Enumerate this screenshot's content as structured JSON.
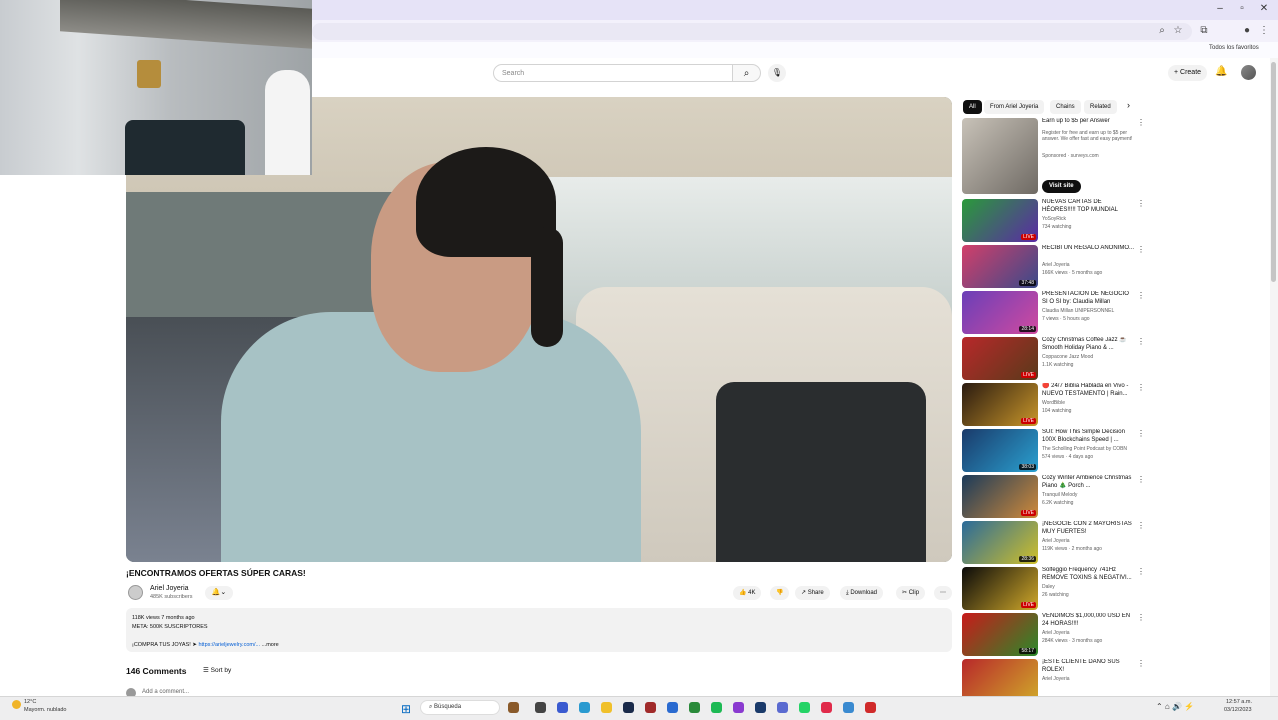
{
  "browser": {
    "bookmarks_label": "Todos los favoritos"
  },
  "header": {
    "search_placeholder": "Search",
    "create_label": "+ Create"
  },
  "video": {
    "title": "¡ENCONTRAMOS OFERTAS SÚPER CARAS!",
    "channel": "Ariel Joyeria",
    "subscribers": "485K subscribers",
    "likes": "4K",
    "share_label": "Share",
    "download_label": "Download",
    "clip_label": "Clip",
    "description_line1": "118K views  7 months ago",
    "description_line2": "META: 500K SUSCRIPTORES",
    "description_line3": "¡COMPRA TUS JOYAS! ➤",
    "description_link": "https://arieljewelry.com/...",
    "description_more": "...more"
  },
  "comments": {
    "count_label": "146 Comments",
    "sort_label": "Sort by",
    "add_placeholder": "Add a comment..."
  },
  "sidebar": {
    "chips": [
      "All",
      "From Ariel Joyeria",
      "Chains",
      "Related"
    ],
    "ad": {
      "title": "Earn up to $5 per Answer",
      "desc": "Register for free and earn up to $5 per answer. We offer fast and easy payment!",
      "sponsor": "Sponsored · surveys.com",
      "button": "Visit site"
    },
    "items": [
      {
        "title": "NUEVAS CARTAS DE HÉORES!!!!! TOP MUNDIAL CLASH ROYALE ...",
        "channel": "YoSoyRick",
        "meta": "734 watching",
        "badge": "LIVE",
        "thumb": "linear-gradient(135deg,#2a9a3a,#5b2aa6)"
      },
      {
        "title": "RECIBÍ UN REGALO ANÓNIMO...",
        "channel": "Ariel Joyeria",
        "meta": "166K views · 5 months ago",
        "badge": "37:48",
        "thumb": "linear-gradient(135deg,#d23f6a,#3a4a8a)"
      },
      {
        "title": "PRESENTACION DE NEGOCIO SI O SI by: Claudia Millan",
        "channel": "Claudia Millan UNIPERSONNEL",
        "meta": "7 views · 5 hours ago",
        "badge": "28:14",
        "thumb": "linear-gradient(135deg,#6a3fb8,#d04aa0)"
      },
      {
        "title": "Cozy Christmas Coffee Jazz ☕ Smooth Holiday Piano & ...",
        "channel": "Coppacone Jazz Mood",
        "meta": "1.1K watching",
        "badge": "LIVE",
        "thumb": "linear-gradient(135deg,#b8282a,#5a3a1a)"
      },
      {
        "title": "🔴 24/7 Biblia Hablada en Vivo - NUEVO TESTAMENTO | Rain...",
        "channel": "WordBible",
        "meta": "104 watching",
        "badge": "LIVE",
        "thumb": "linear-gradient(135deg,#2a1a10,#c8962a)"
      },
      {
        "title": "SUI: How This Simple Decision 100X Blockchains Speed | ...",
        "channel": "The Scholling Point Podcast by COBN",
        "meta": "574 views · 4 days ago",
        "badge": "38:03",
        "thumb": "linear-gradient(135deg,#1a3a6a,#2aa0d0)"
      },
      {
        "title": "Cozy Winter Ambience Christmas Piano 🎄 Porch ...",
        "channel": "Tranquil Melody",
        "meta": "6.2K watching",
        "badge": "LIVE",
        "thumb": "linear-gradient(135deg,#1a3a5a,#d08a3a)"
      },
      {
        "title": "¡NEGOCIÉ CON 2 MAYORISTAS MUY FUERTES!",
        "channel": "Ariel Joyeria",
        "meta": "119K views · 2 months ago",
        "badge": "28:36",
        "thumb": "linear-gradient(135deg,#2a6a9a,#d0c02a)"
      },
      {
        "title": "Solfeggio Frequency 741Hz REMOVE TOXINS & NEGATIVI...",
        "channel": "Daley",
        "meta": "26 watching",
        "badge": "LIVE",
        "thumb": "linear-gradient(135deg,#0a0a0a,#d0a82a)"
      },
      {
        "title": "VENDIMOS $1,000,000 USD EN 24 HORAS!!!!",
        "channel": "Ariel Joyeria",
        "meta": "284K views · 3 months ago",
        "badge": "58:17",
        "thumb": "linear-gradient(135deg,#c81a1a,#2a8a2a)"
      },
      {
        "title": "¡ESTE CLIENTE DAÑÓ SUS ROLEX!",
        "channel": "Ariel Joyeria",
        "meta": "",
        "badge": "",
        "thumb": "linear-gradient(135deg,#b8282a,#d0a82a)"
      }
    ]
  },
  "taskbar": {
    "weather_temp": "12°C",
    "weather_text": "Mayorm. nublado",
    "search_label": "Búsqueda",
    "time": "12:57 a.m.",
    "date": "03/12/2023"
  }
}
